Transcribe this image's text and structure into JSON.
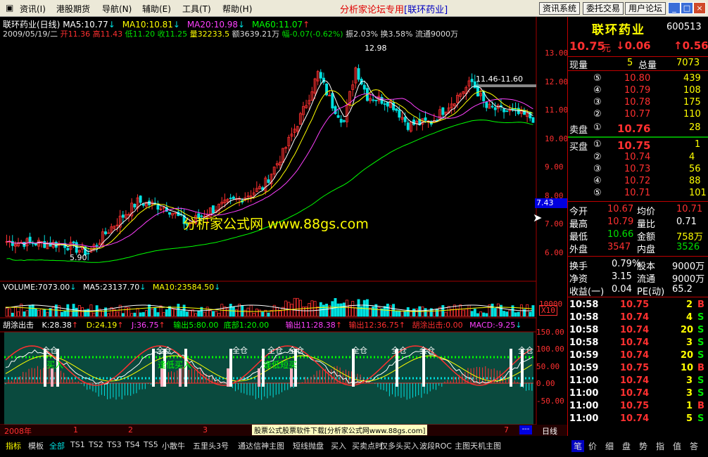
{
  "menu": {
    "items": [
      "资讯(I)",
      "港股期货",
      "导航(N)",
      "辅助(E)",
      "工具(T)",
      "帮助(H)"
    ],
    "title_prefix": "分析家论坛专用",
    "title_name": "[联环药业]",
    "btn_news": "资讯系统",
    "btn_trade": "委托交易",
    "btn_forum": "用户论坛"
  },
  "chart_header": {
    "name": "联环药业(日线)",
    "ma5": "MA5:10.77",
    "ma10": "MA10:10.81",
    "ma20": "MA20:10.98",
    "ma60": "MA60:11.07",
    "date": "2009/05/19/二",
    "open": "开11.36",
    "high": "高11.43",
    "low": "低11.20",
    "close": "收11.25",
    "vol": "量32233.5",
    "amount": "额3639.21万",
    "change": "幅-0.07(-0.62%)",
    "amp": "振2.03%",
    "turnover": "换3.58%",
    "float": "流通9000万"
  },
  "annotations": {
    "high_label": "12.98",
    "low_label": "5.90",
    "range_label": "11.46-11.60",
    "cursor_price": "7.43",
    "watermark": "分析家公式网 www.88gs.com"
  },
  "price_axis": [
    "13.00",
    "12.00",
    "11.00",
    "10.00",
    "9.00",
    "8.00",
    "7.00",
    "6.00"
  ],
  "volume_header": {
    "label": "VOLUME:7073.00",
    "ma5": "MA5:23137.70",
    "ma10": "MA10:23584.50"
  },
  "volume_axis": {
    "top": "10000",
    "unit": "X10"
  },
  "indicator_header": {
    "name": "胡涂出击",
    "k": "K:28.38",
    "d": "D:24.19",
    "j": "J:36.75",
    "out5": "输出5:80.00",
    "bottom": "底部1:20.00",
    "out11": "输出11:28.38",
    "out12": "输出12:36.75",
    "exit": "胡涂出击:0.00",
    "macd": "MACD:-9.25"
  },
  "indicator_axis": [
    "150.00",
    "100.00",
    "50.00",
    "0.00",
    "-50.00"
  ],
  "indicator_labels": {
    "full": "全仓",
    "buy": "买入",
    "good_buy": "逢低买入",
    "hold_buy": "逢低短买"
  },
  "time_axis": {
    "year": "2008年",
    "marks": [
      "1",
      "2",
      "3",
      "7"
    ],
    "period": "日线"
  },
  "ad_text": "股票公式股票软件下载[分析家公式网www.88gs.com]",
  "panel": {
    "stock_name": "联环药业",
    "code": "600513",
    "price": "10.75",
    "yuan": "元",
    "change": "↓0.06",
    "change_pct": "↑0.56",
    "now_label": "现量",
    "now_val": "5",
    "total_label": "总量",
    "total_val": "7073",
    "sells": [
      {
        "lvl": "⑤",
        "price": "10.80",
        "vol": "439"
      },
      {
        "lvl": "④",
        "price": "10.79",
        "vol": "108"
      },
      {
        "lvl": "③",
        "price": "10.78",
        "vol": "175"
      },
      {
        "lvl": "②",
        "price": "10.77",
        "vol": "110"
      }
    ],
    "sell1_label": "卖盘",
    "sell1_lvl": "①",
    "sell1_price": "10.76",
    "sell1_vol": "28",
    "buy1_label": "买盘",
    "buy1_lvl": "①",
    "buy1_price": "10.75",
    "buy1_vol": "1",
    "buys": [
      {
        "lvl": "②",
        "price": "10.74",
        "vol": "4"
      },
      {
        "lvl": "③",
        "price": "10.73",
        "vol": "56"
      },
      {
        "lvl": "④",
        "price": "10.72",
        "vol": "88"
      },
      {
        "lvl": "⑤",
        "price": "10.71",
        "vol": "101"
      }
    ],
    "stats": [
      {
        "a": "今开",
        "av": "10.67",
        "b": "均价",
        "bv": "10.71"
      },
      {
        "a": "最高",
        "av": "10.79",
        "b": "量比",
        "bv": "0.71"
      },
      {
        "a": "最低",
        "av": "10.66",
        "b": "金额",
        "bv": "758万"
      },
      {
        "a": "外盘",
        "av": "3547",
        "b": "内盘",
        "bv": "3526"
      }
    ],
    "stats2": [
      {
        "a": "换手",
        "av": "0.79%",
        "b": "股本",
        "bv": "9000万"
      },
      {
        "a": "净资",
        "av": "3.15",
        "b": "流通",
        "bv": "9000万"
      },
      {
        "a": "收益(一)",
        "av": "0.04",
        "b": "PE(动)",
        "bv": "65.2"
      }
    ],
    "ticks": [
      {
        "t": "10:58",
        "p": "10.75",
        "v": "2",
        "s": "B"
      },
      {
        "t": "10:58",
        "p": "10.74",
        "v": "4",
        "s": "S"
      },
      {
        "t": "10:58",
        "p": "10.74",
        "v": "20",
        "s": "S"
      },
      {
        "t": "10:58",
        "p": "10.74",
        "v": "3",
        "s": "S"
      },
      {
        "t": "10:59",
        "p": "10.74",
        "v": "20",
        "s": "S"
      },
      {
        "t": "10:59",
        "p": "10.75",
        "v": "10",
        "s": "B"
      },
      {
        "t": "11:00",
        "p": "10.74",
        "v": "3",
        "s": "S"
      },
      {
        "t": "11:00",
        "p": "10.74",
        "v": "3",
        "s": "S"
      },
      {
        "t": "11:00",
        "p": "10.75",
        "v": "1",
        "s": "B"
      },
      {
        "t": "11:00",
        "p": "10.74",
        "v": "5",
        "s": "S"
      }
    ]
  },
  "tabs": [
    "指标",
    "模板",
    "全部",
    "TS1",
    "TS2",
    "TS3",
    "TS4",
    "TS5",
    "小散牛",
    "五里头3号",
    "通达信神主图",
    "短线抛盘",
    "买入",
    "买卖点时",
    "仅多头买入",
    "波段ROC",
    "主图天机主图"
  ],
  "right_tabs": [
    "笔",
    "价",
    "细",
    "盘",
    "势",
    "指",
    "值",
    "答"
  ],
  "colors": {
    "up": "#ff3030",
    "down": "#00e0e0",
    "ma5": "#ffffff",
    "ma10": "#ffff00",
    "ma20": "#ff40ff",
    "ma60": "#00ff00"
  },
  "chart_data": {
    "type": "candlestick",
    "ylim": [
      5.5,
      13.3
    ],
    "price_range_high": 12.98,
    "price_range_low": 5.9,
    "ma": {
      "ma5": 10.77,
      "ma10": 10.81,
      "ma20": 10.98,
      "ma60": 11.07
    }
  }
}
